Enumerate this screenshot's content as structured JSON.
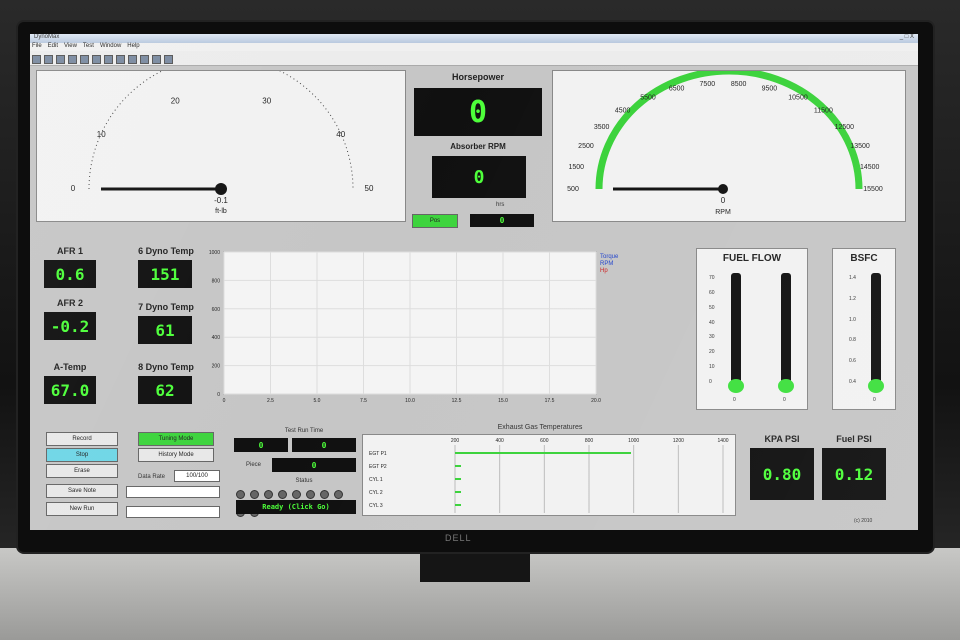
{
  "window": {
    "title": "DynoMax",
    "controls": "_ □ X",
    "status_right": "(c) 2010"
  },
  "menu": [
    "File",
    "Edit",
    "View",
    "Test",
    "Window",
    "Help"
  ],
  "torque_gauge": {
    "ticks": [
      "0",
      "10",
      "20",
      "30",
      "40",
      "50"
    ],
    "readout": "-0.1",
    "unit": "ft-lb",
    "value": -0.1,
    "max": 50
  },
  "horsepower": {
    "title": "Horsepower",
    "value": "0"
  },
  "absorber_rpm": {
    "title": "Absorber RPM",
    "value": "0",
    "sub_label": "hrs",
    "small_value": "0",
    "indicator": "Pos"
  },
  "rpm_gauge": {
    "ticks": [
      "500",
      "1500",
      "2500",
      "3500",
      "4500",
      "5500",
      "6500",
      "7500",
      "8500",
      "9500",
      "10500",
      "11500",
      "12500",
      "13500",
      "14500",
      "15500"
    ],
    "readout": "0",
    "unit": "RPM",
    "value": 0,
    "min": 500,
    "max": 15500
  },
  "readouts": [
    {
      "label": "AFR 1",
      "value": "0.6"
    },
    {
      "label": "AFR 2",
      "value": "-0.2"
    },
    {
      "label": "A-Temp",
      "value": "67.0"
    },
    {
      "label": "6 Dyno Temp",
      "value": "151"
    },
    {
      "label": "7 Dyno Temp",
      "value": "61"
    },
    {
      "label": "8 Dyno Temp",
      "value": "62"
    }
  ],
  "plot": {
    "y_ticks": [
      "1000",
      "800",
      "600",
      "400",
      "200",
      "0"
    ],
    "x_ticks": [
      "0",
      "2.5",
      "5.0",
      "7.5",
      "10.0",
      "12.5",
      "15.0",
      "17.5",
      "20.0"
    ],
    "legend": [
      "Torque",
      "RPM",
      "Hp"
    ]
  },
  "fuel_flow": {
    "title": "FUEL FLOW",
    "ticks": [
      "70",
      "60",
      "50",
      "40",
      "30",
      "20",
      "10",
      "0"
    ],
    "readout_a": "0",
    "readout_b": "0"
  },
  "bsfc": {
    "title": "BSFC",
    "ticks": [
      "1.4",
      "1.2",
      "1.0",
      "0.8",
      "0.6",
      "0.4"
    ],
    "readout": "0"
  },
  "buttons": {
    "record": "Record",
    "stop": "Stop",
    "erase": "Erase",
    "save_note": "Save Note",
    "new_run": "New Run",
    "tuning": "Tuning Mode",
    "history": "History Mode"
  },
  "test_run": {
    "title": "Test Run Time",
    "value_a": "0",
    "value_b": "0",
    "piece_label": "Piece",
    "piece_value": "0",
    "status_title": "Status",
    "status_value": "Ready (Click Go)"
  },
  "inputs": {
    "data_rate_label": "Data Rate",
    "data_rate_value": "100/100"
  },
  "egt": {
    "title": "Exhaust Gas Temperatures",
    "scale": [
      "200",
      "400",
      "600",
      "800",
      "1000",
      "1200",
      "1400"
    ],
    "rows": [
      "EGT P1",
      "EGT P2",
      "CYL 1",
      "CYL 2",
      "CYL 3"
    ]
  },
  "kpa": {
    "title": "KPA PSI",
    "value": "0.80"
  },
  "fuel_psi": {
    "title": "Fuel PSI",
    "value": "0.12"
  },
  "colors": {
    "digits": "#4dff3a",
    "gauge_arc": "#3ad23a",
    "screen_bg": "#c6c6c6"
  }
}
